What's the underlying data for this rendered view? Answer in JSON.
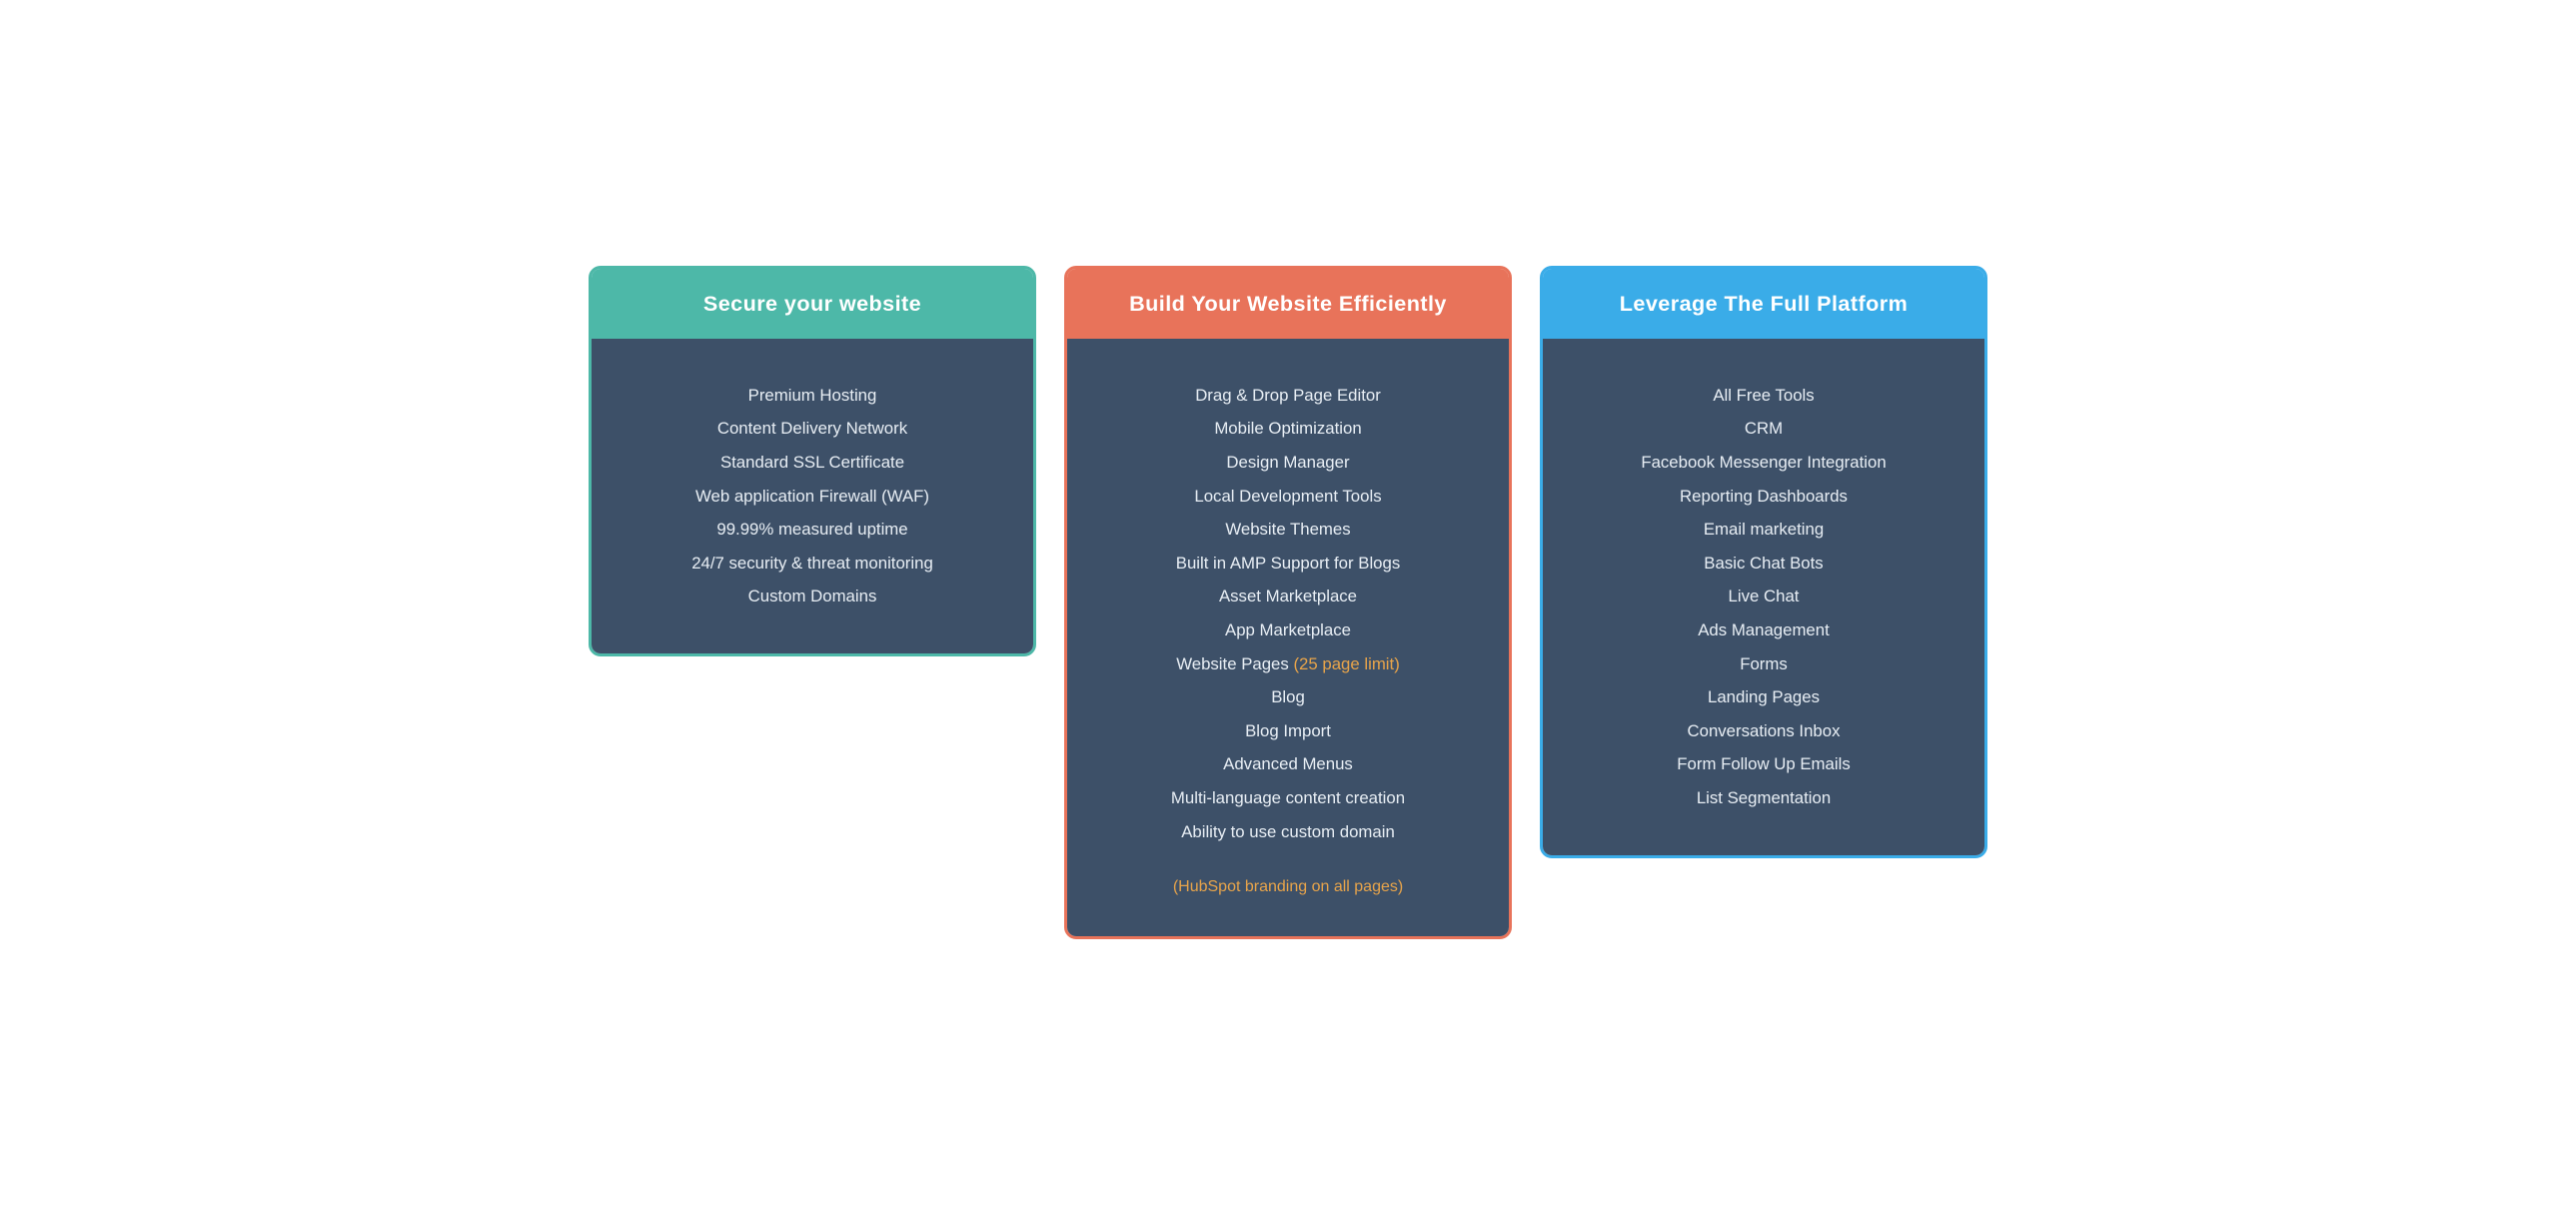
{
  "cards": [
    {
      "id": "secure",
      "title": "Secure your website",
      "header_style": "teal",
      "border_style": "teal",
      "items": [
        {
          "text": "Premium Hosting",
          "highlight": false
        },
        {
          "text": "Content Delivery Network",
          "highlight": false
        },
        {
          "text": "Standard SSL Certificate",
          "highlight": false
        },
        {
          "text": "Web application Firewall (WAF)",
          "highlight": false
        },
        {
          "text": "99.99% measured uptime",
          "highlight": false
        },
        {
          "text": "24/7 security & threat monitoring",
          "highlight": false
        },
        {
          "text": "Custom Domains",
          "highlight": false
        }
      ],
      "footer_text": null
    },
    {
      "id": "build",
      "title": "Build Your Website Efficiently",
      "header_style": "orange",
      "border_style": "orange",
      "items": [
        {
          "text": "Drag & Drop Page Editor",
          "highlight": false
        },
        {
          "text": "Mobile Optimization",
          "highlight": false
        },
        {
          "text": "Design Manager",
          "highlight": false
        },
        {
          "text": "Local Development Tools",
          "highlight": false
        },
        {
          "text": "Website Themes",
          "highlight": false
        },
        {
          "text": "Built in AMP Support for Blogs",
          "highlight": false
        },
        {
          "text": "Asset Marketplace",
          "highlight": false
        },
        {
          "text": "App Marketplace",
          "highlight": false
        },
        {
          "text": "Website Pages",
          "highlight": false,
          "inline_highlight": "(25 page limit)"
        },
        {
          "text": "Blog",
          "highlight": false
        },
        {
          "text": "Blog Import",
          "highlight": false
        },
        {
          "text": "Advanced Menus",
          "highlight": false
        },
        {
          "text": "Multi-language content creation",
          "highlight": false
        },
        {
          "text": "Ability to use custom domain",
          "highlight": false
        }
      ],
      "footer_text": "(HubSpot branding on all pages)"
    },
    {
      "id": "leverage",
      "title": "Leverage The Full Platform",
      "header_style": "blue",
      "border_style": "blue",
      "items": [
        {
          "text": "All Free Tools",
          "highlight": false
        },
        {
          "text": "CRM",
          "highlight": false
        },
        {
          "text": "Facebook Messenger Integration",
          "highlight": false
        },
        {
          "text": "Reporting Dashboards",
          "highlight": false
        },
        {
          "text": "Email marketing",
          "highlight": false
        },
        {
          "text": "Basic Chat Bots",
          "highlight": false
        },
        {
          "text": "Live Chat",
          "highlight": false
        },
        {
          "text": "Ads Management",
          "highlight": false
        },
        {
          "text": "Forms",
          "highlight": false
        },
        {
          "text": "Landing Pages",
          "highlight": false
        },
        {
          "text": "Conversations Inbox",
          "highlight": false
        },
        {
          "text": "Form Follow Up Emails",
          "highlight": false
        },
        {
          "text": "List Segmentation",
          "highlight": false
        }
      ],
      "footer_text": null
    }
  ],
  "colors": {
    "teal": "#4db8a8",
    "orange": "#e8735a",
    "blue": "#3aace8",
    "body_bg": "#3d5068",
    "text_light": "#e8eef4",
    "highlight_orange": "#e8a44a"
  }
}
